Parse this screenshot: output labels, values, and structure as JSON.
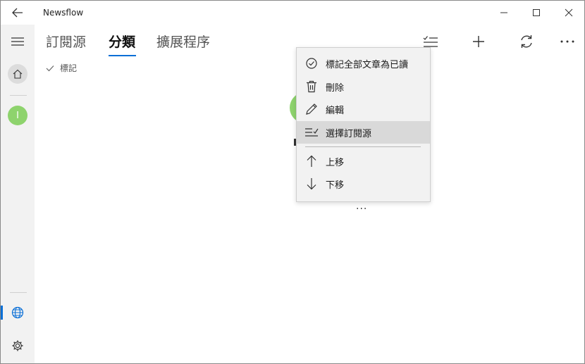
{
  "window": {
    "title": "Newsflow"
  },
  "tabs": [
    {
      "label": "訂閱源"
    },
    {
      "label": "分類"
    },
    {
      "label": "擴展程序"
    }
  ],
  "sub_action": {
    "label": "標記"
  },
  "context_menu": {
    "items": [
      {
        "label": "標記全部文章為已讀",
        "icon": "check-circle-icon"
      },
      {
        "label": "刪除",
        "icon": "trash-icon"
      },
      {
        "label": "編輯",
        "icon": "pencil-icon"
      },
      {
        "label": "選擇訂閱源",
        "icon": "select-list-icon",
        "highlighted": true
      },
      {
        "label": "上移",
        "icon": "arrow-up-icon"
      },
      {
        "label": "下移",
        "icon": "arrow-down-icon"
      }
    ]
  },
  "rail": {
    "avatar_letter": "I"
  },
  "colors": {
    "accent": "#0a6fd6",
    "avatar": "#8ed36d",
    "rail_bg": "#f2f2f2",
    "menu_bg": "#f2f2f2"
  },
  "card": {
    "more": "..."
  }
}
